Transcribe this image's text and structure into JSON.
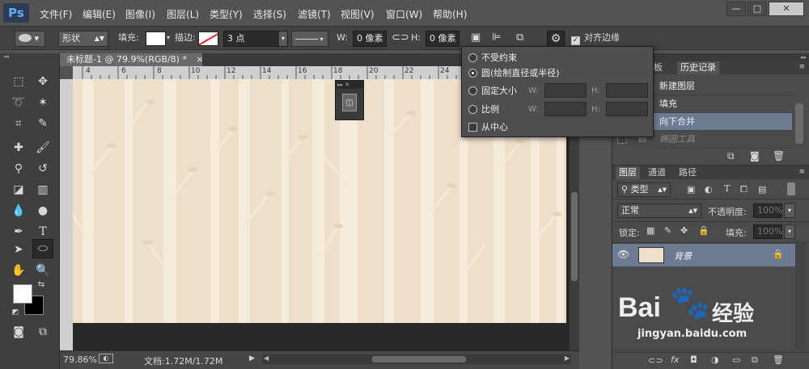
{
  "app": {
    "logo": "Ps"
  },
  "menu": [
    "文件(F)",
    "编辑(E)",
    "图像(I)",
    "图层(L)",
    "类型(Y)",
    "选择(S)",
    "滤镜(T)",
    "视图(V)",
    "窗口(W)",
    "帮助(H)"
  ],
  "window_controls": {
    "minimize": "—",
    "restore": "□",
    "close": "✕"
  },
  "options": {
    "mode": "形状",
    "fill_label": "填充:",
    "stroke_label": "描边:",
    "stroke_size": "3 点",
    "w_label": "W:",
    "w_value": "0 像素",
    "h_label": "H:",
    "h_value": "0 像素",
    "align_edges": "对齐边缘"
  },
  "document": {
    "tab_title": "未标题-1 @ 79.9%(RGB/8) *",
    "close": "×",
    "ruler_ticks": [
      "4",
      "6",
      "8",
      "10",
      "12",
      "14",
      "16",
      "18",
      "20",
      "22",
      "24",
      "26",
      "28",
      "30"
    ],
    "canvas_color": "#eedfcb"
  },
  "status": {
    "zoom": "79.86%",
    "doc_info": "文档:1.72M/1.72M"
  },
  "geometry_popup": {
    "options": [
      {
        "label": "不受约束",
        "checked": false
      },
      {
        "label": "圆(绘制直径或半径)",
        "checked": true
      },
      {
        "label": "固定大小",
        "checked": false
      },
      {
        "label": "比例",
        "checked": false
      }
    ],
    "w_label": "W:",
    "h_label": "H:",
    "from_center": "从中心"
  },
  "history": {
    "tabs": [
      "色板",
      "历史记录"
    ],
    "items": [
      {
        "label": "新建图层",
        "selected": false
      },
      {
        "label": "填充",
        "selected": false
      },
      {
        "label": "向下合并",
        "selected": true
      },
      {
        "label": "椭圆工具",
        "selected": false
      }
    ]
  },
  "layers": {
    "tabs": [
      "图层",
      "通道",
      "路径"
    ],
    "filter_kind": "类型",
    "blend_mode": "正常",
    "opacity_label": "不透明度:",
    "opacity_value": "100%",
    "lock_label": "锁定:",
    "fill_label": "填充:",
    "fill_value": "100%",
    "items": [
      {
        "name": "背景",
        "locked": true
      }
    ]
  },
  "watermark": {
    "brand": "Bai",
    "brand_cn": "经验",
    "url": "jingyan.baidu.com"
  }
}
